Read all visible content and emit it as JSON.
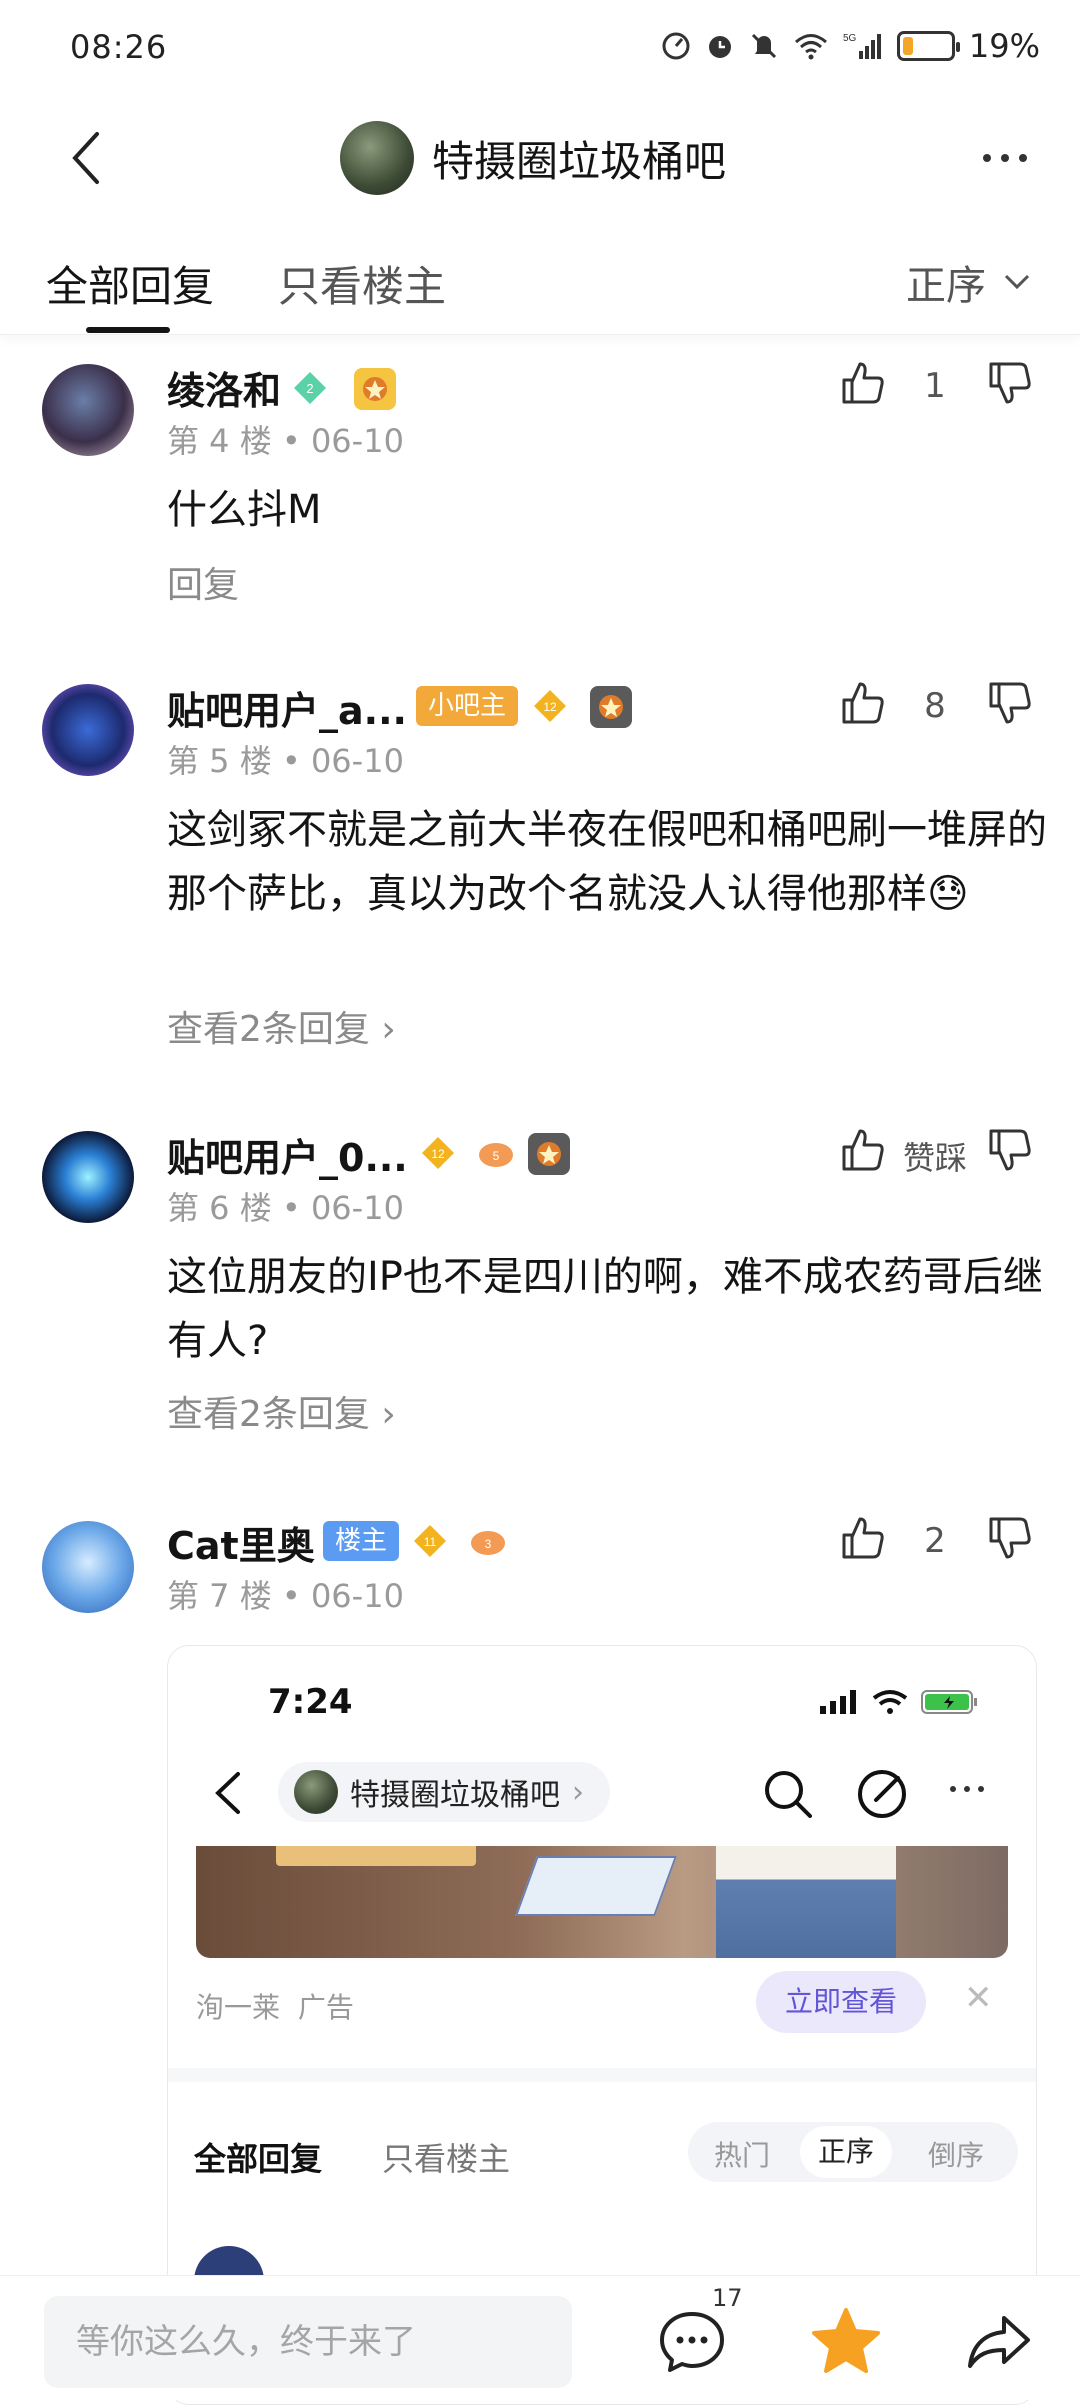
{
  "status_bar": {
    "time": "08:26",
    "battery_percent": "19%",
    "battery_level": 0.19
  },
  "nav": {
    "title": "特摄圈垃圾桶吧"
  },
  "tabs": {
    "all": "全部回复",
    "owner_only": "只看楼主",
    "sort": "正序"
  },
  "posts": [
    {
      "username": "绫洛和",
      "level": "2",
      "floor": "第 4 楼",
      "date": "06-10",
      "likes": "1",
      "content": "什么抖M",
      "reply_link": "回复"
    },
    {
      "username": "贴吧用户_a...",
      "role_badge": "小吧主",
      "level": "12",
      "floor": "第 5 楼",
      "date": "06-10",
      "likes": "8",
      "content": "这剑冢不就是之前大半夜在假吧和桶吧刷一堆屏的那个萨比，真以为改个名就没人认得他那样😓",
      "reply_link": "查看2条回复 ›"
    },
    {
      "username": "贴吧用户_0...",
      "level": "12",
      "extra_level": "5",
      "floor": "第 6 楼",
      "date": "06-10",
      "likes": "赞踩",
      "content": "这位朋友的IP也不是四川的啊，难不成农药哥后继有人?",
      "reply_link": "查看2条回复 ›"
    },
    {
      "username": "Cat里奥",
      "role_badge": "楼主",
      "level": "11",
      "extra_level": "3",
      "floor": "第 7 楼",
      "date": "06-10",
      "likes": "2"
    }
  ],
  "embedded": {
    "time": "7:24",
    "forum_name": "特摄圈垃圾桶吧",
    "ad_source": "洵一莱",
    "ad_label": "广告",
    "ad_button": "立即查看",
    "tab_all": "全部回复",
    "tab_owner": "只看楼主",
    "sort_hot": "热门",
    "sort_asc": "正序",
    "sort_desc": "倒序"
  },
  "bottom_bar": {
    "placeholder": "等你这么久，终于来了",
    "comment_count": "17"
  },
  "colors": {
    "level_badge": "#f2b31e",
    "owner_badge": "#5b9cf2",
    "mod_badge": "#f3a93a",
    "star": "#f6a122"
  }
}
